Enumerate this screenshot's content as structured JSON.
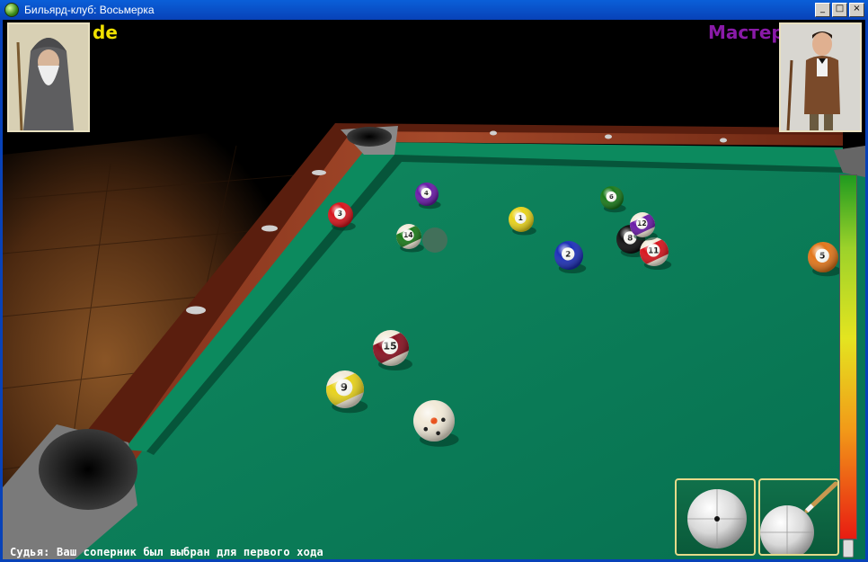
{
  "window": {
    "title": "Бильярд-клуб: Восьмерка",
    "minimize_label": "_",
    "maximize_label": "□",
    "close_label": "×"
  },
  "players": {
    "left": {
      "name": "de",
      "name_color": "#f0e000"
    },
    "right": {
      "name": "Мастер",
      "name_color": "#8a1aa8"
    }
  },
  "balls": [
    {
      "id": "cue",
      "number": "",
      "color": "#f2ead8",
      "stripe": false
    },
    {
      "id": "ball-1",
      "number": "1",
      "color": "#e8d21a",
      "stripe": false
    },
    {
      "id": "ball-2",
      "number": "2",
      "color": "#1d2fb8",
      "stripe": false
    },
    {
      "id": "ball-3",
      "number": "3",
      "color": "#d8141c",
      "stripe": false
    },
    {
      "id": "ball-4",
      "number": "4",
      "color": "#6a1aa8",
      "stripe": false
    },
    {
      "id": "ball-5",
      "number": "5",
      "color": "#e2761a",
      "stripe": false
    },
    {
      "id": "ball-6",
      "number": "6",
      "color": "#1a7a1a",
      "stripe": false
    },
    {
      "id": "ball-8",
      "number": "8",
      "color": "#111111",
      "stripe": false
    },
    {
      "id": "ball-9",
      "number": "9",
      "color": "#e8d21a",
      "stripe": true
    },
    {
      "id": "ball-11",
      "number": "11",
      "color": "#d8141c",
      "stripe": true
    },
    {
      "id": "ball-12",
      "number": "12",
      "color": "#6a1aa8",
      "stripe": true
    },
    {
      "id": "ball-14",
      "number": "14",
      "color": "#1a7a1a",
      "stripe": true
    },
    {
      "id": "ball-15",
      "number": "15",
      "color": "#8a1020",
      "stripe": true
    }
  ],
  "status_text": "Судья: Ваш соперник был выбран для первого хода",
  "colors": {
    "felt": "#0a7a55",
    "rail_wood": "#8a3a22",
    "floor": "#5a3214",
    "panel_border": "#e6da8a"
  }
}
